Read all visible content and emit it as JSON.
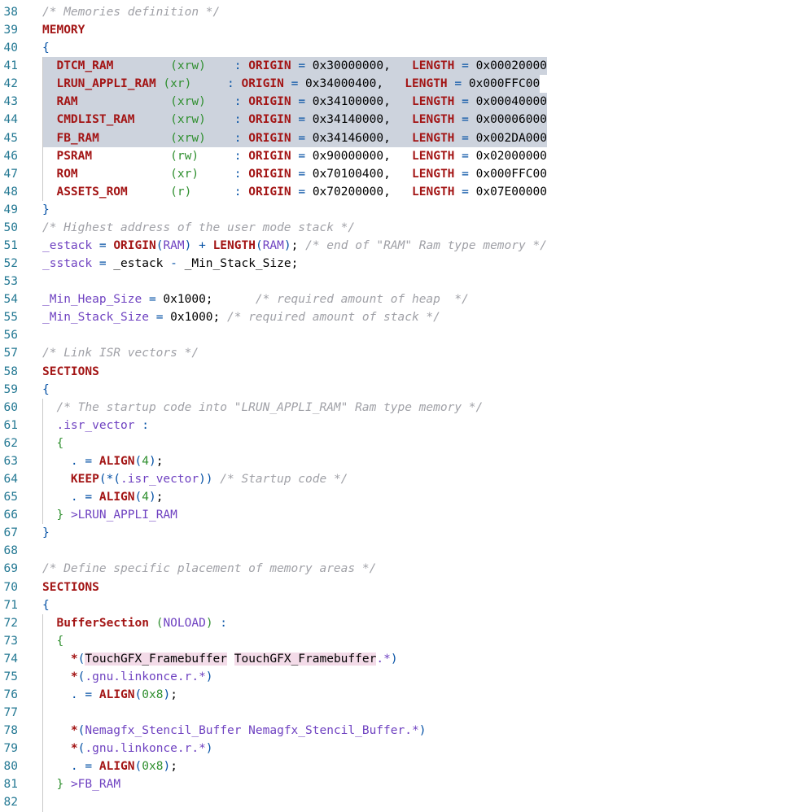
{
  "editor": {
    "lines": [
      {
        "n": "38",
        "tokens": [
          [
            "c",
            "/* Memories definition */"
          ]
        ]
      },
      {
        "n": "39",
        "tokens": [
          [
            "k",
            "MEMORY"
          ]
        ]
      },
      {
        "n": "40",
        "tokens": [
          [
            "p",
            "{"
          ]
        ]
      },
      {
        "n": "41",
        "sel": true,
        "tokens": [
          [
            "t",
            "  "
          ],
          [
            "k",
            "DTCM_RAM"
          ],
          [
            "t",
            "        "
          ],
          [
            "g",
            "(xrw)"
          ],
          [
            "t",
            "    "
          ],
          [
            "p",
            ":"
          ],
          [
            "t",
            " "
          ],
          [
            "k",
            "ORIGIN"
          ],
          [
            "t",
            " "
          ],
          [
            "p",
            "="
          ],
          [
            "t",
            " 0x30000000,   "
          ],
          [
            "k",
            "LENGTH"
          ],
          [
            "t",
            " "
          ],
          [
            "p",
            "="
          ],
          [
            "t",
            " 0x00020000"
          ]
        ]
      },
      {
        "n": "42",
        "sel": true,
        "tokens": [
          [
            "t",
            "  "
          ],
          [
            "k",
            "LRUN_APPLI_RAM"
          ],
          [
            "t",
            " "
          ],
          [
            "g",
            "(xr)"
          ],
          [
            "t",
            "     "
          ],
          [
            "p",
            ":"
          ],
          [
            "t",
            " "
          ],
          [
            "k",
            "ORIGIN"
          ],
          [
            "t",
            " "
          ],
          [
            "p",
            "="
          ],
          [
            "t",
            " 0x34000400,   "
          ],
          [
            "k",
            "LENGTH"
          ],
          [
            "t",
            " "
          ],
          [
            "p",
            "="
          ],
          [
            "t",
            " 0x000FFC00"
          ]
        ]
      },
      {
        "n": "43",
        "sel": true,
        "tokens": [
          [
            "t",
            "  "
          ],
          [
            "k",
            "RAM"
          ],
          [
            "t",
            "             "
          ],
          [
            "g",
            "(xrw)"
          ],
          [
            "t",
            "    "
          ],
          [
            "p",
            ":"
          ],
          [
            "t",
            " "
          ],
          [
            "k",
            "ORIGIN"
          ],
          [
            "t",
            " "
          ],
          [
            "p",
            "="
          ],
          [
            "t",
            " 0x34100000,   "
          ],
          [
            "k",
            "LENGTH"
          ],
          [
            "t",
            " "
          ],
          [
            "p",
            "="
          ],
          [
            "t",
            " 0x00040000"
          ]
        ]
      },
      {
        "n": "44",
        "sel": true,
        "tokens": [
          [
            "t",
            "  "
          ],
          [
            "k",
            "CMDLIST_RAM"
          ],
          [
            "t",
            "     "
          ],
          [
            "g",
            "(xrw)"
          ],
          [
            "t",
            "    "
          ],
          [
            "p",
            ":"
          ],
          [
            "t",
            " "
          ],
          [
            "k",
            "ORIGIN"
          ],
          [
            "t",
            " "
          ],
          [
            "p",
            "="
          ],
          [
            "t",
            " 0x34140000,   "
          ],
          [
            "k",
            "LENGTH"
          ],
          [
            "t",
            " "
          ],
          [
            "p",
            "="
          ],
          [
            "t",
            " 0x00006000"
          ]
        ]
      },
      {
        "n": "45",
        "sel": true,
        "tokens": [
          [
            "t",
            "  "
          ],
          [
            "k",
            "FB_RAM"
          ],
          [
            "t",
            "          "
          ],
          [
            "g",
            "(xrw)"
          ],
          [
            "t",
            "    "
          ],
          [
            "p",
            ":"
          ],
          [
            "t",
            " "
          ],
          [
            "k",
            "ORIGIN"
          ],
          [
            "t",
            " "
          ],
          [
            "p",
            "="
          ],
          [
            "t",
            " 0x34146000,   "
          ],
          [
            "k",
            "LENGTH"
          ],
          [
            "t",
            " "
          ],
          [
            "p",
            "="
          ],
          [
            "t",
            " 0x002DA000"
          ]
        ]
      },
      {
        "n": "46",
        "tokens": [
          [
            "t",
            "  "
          ],
          [
            "k",
            "PSRAM"
          ],
          [
            "t",
            "           "
          ],
          [
            "g",
            "(rw)"
          ],
          [
            "t",
            "     "
          ],
          [
            "p",
            ":"
          ],
          [
            "t",
            " "
          ],
          [
            "k",
            "ORIGIN"
          ],
          [
            "t",
            " "
          ],
          [
            "p",
            "="
          ],
          [
            "t",
            " 0x90000000,   "
          ],
          [
            "k",
            "LENGTH"
          ],
          [
            "t",
            " "
          ],
          [
            "p",
            "="
          ],
          [
            "t",
            " 0x02000000"
          ]
        ]
      },
      {
        "n": "47",
        "tokens": [
          [
            "t",
            "  "
          ],
          [
            "k",
            "ROM"
          ],
          [
            "t",
            "             "
          ],
          [
            "g",
            "(xr)"
          ],
          [
            "t",
            "     "
          ],
          [
            "p",
            ":"
          ],
          [
            "t",
            " "
          ],
          [
            "k",
            "ORIGIN"
          ],
          [
            "t",
            " "
          ],
          [
            "p",
            "="
          ],
          [
            "t",
            " 0x70100400,   "
          ],
          [
            "k",
            "LENGTH"
          ],
          [
            "t",
            " "
          ],
          [
            "p",
            "="
          ],
          [
            "t",
            " 0x000FFC00"
          ]
        ]
      },
      {
        "n": "48",
        "tokens": [
          [
            "t",
            "  "
          ],
          [
            "k",
            "ASSETS_ROM"
          ],
          [
            "t",
            "      "
          ],
          [
            "g",
            "(r)"
          ],
          [
            "t",
            "      "
          ],
          [
            "p",
            ":"
          ],
          [
            "t",
            " "
          ],
          [
            "k",
            "ORIGIN"
          ],
          [
            "t",
            " "
          ],
          [
            "p",
            "="
          ],
          [
            "t",
            " 0x70200000,   "
          ],
          [
            "k",
            "LENGTH"
          ],
          [
            "t",
            " "
          ],
          [
            "p",
            "="
          ],
          [
            "t",
            " 0x07E00000"
          ]
        ]
      },
      {
        "n": "49",
        "tokens": [
          [
            "p",
            "}"
          ]
        ]
      },
      {
        "n": "50",
        "tokens": [
          [
            "c",
            "/* Highest address of the user mode stack */"
          ]
        ]
      },
      {
        "n": "51",
        "tokens": [
          [
            "n",
            "_estack"
          ],
          [
            "t",
            " "
          ],
          [
            "p",
            "="
          ],
          [
            "t",
            " "
          ],
          [
            "k",
            "ORIGIN"
          ],
          [
            "p",
            "("
          ],
          [
            "n",
            "RAM"
          ],
          [
            "p",
            ")"
          ],
          [
            "t",
            " "
          ],
          [
            "p",
            "+"
          ],
          [
            "t",
            " "
          ],
          [
            "k",
            "LENGTH"
          ],
          [
            "p",
            "("
          ],
          [
            "n",
            "RAM"
          ],
          [
            "p",
            ")"
          ],
          [
            "t",
            "; "
          ],
          [
            "c",
            "/* end of \"RAM\" Ram type memory */"
          ]
        ]
      },
      {
        "n": "52",
        "tokens": [
          [
            "n",
            "_sstack"
          ],
          [
            "t",
            " "
          ],
          [
            "p",
            "="
          ],
          [
            "t",
            " _estack "
          ],
          [
            "p",
            "-"
          ],
          [
            "t",
            " _Min_Stack_Size;"
          ]
        ]
      },
      {
        "n": "53",
        "tokens": []
      },
      {
        "n": "54",
        "tokens": [
          [
            "n",
            "_Min_Heap_Size"
          ],
          [
            "t",
            " "
          ],
          [
            "p",
            "="
          ],
          [
            "t",
            " 0x1000;      "
          ],
          [
            "c",
            "/* required amount of heap  */"
          ]
        ]
      },
      {
        "n": "55",
        "tokens": [
          [
            "n",
            "_Min_Stack_Size"
          ],
          [
            "t",
            " "
          ],
          [
            "p",
            "="
          ],
          [
            "t",
            " 0x1000; "
          ],
          [
            "c",
            "/* required amount of stack */"
          ]
        ]
      },
      {
        "n": "56",
        "tokens": []
      },
      {
        "n": "57",
        "tokens": [
          [
            "c",
            "/* Link ISR vectors */"
          ]
        ]
      },
      {
        "n": "58",
        "tokens": [
          [
            "k",
            "SECTIONS"
          ]
        ]
      },
      {
        "n": "59",
        "tokens": [
          [
            "p",
            "{"
          ]
        ]
      },
      {
        "n": "60",
        "tokens": [
          [
            "t",
            "  "
          ],
          [
            "c",
            "/* The startup code into \"LRUN_APPLI_RAM\" Ram type memory */"
          ]
        ]
      },
      {
        "n": "61",
        "tokens": [
          [
            "t",
            "  "
          ],
          [
            "n",
            ".isr_vector"
          ],
          [
            "t",
            " "
          ],
          [
            "p",
            ":"
          ]
        ]
      },
      {
        "n": "62",
        "tokens": [
          [
            "t",
            "  "
          ],
          [
            "g",
            "{"
          ]
        ]
      },
      {
        "n": "63",
        "tokens": [
          [
            "t",
            "    "
          ],
          [
            "p",
            "."
          ],
          [
            "t",
            " "
          ],
          [
            "p",
            "="
          ],
          [
            "t",
            " "
          ],
          [
            "k",
            "ALIGN"
          ],
          [
            "p",
            "("
          ],
          [
            "g",
            "4"
          ],
          [
            "p",
            ")"
          ],
          [
            "t",
            ";"
          ]
        ]
      },
      {
        "n": "64",
        "tokens": [
          [
            "t",
            "    "
          ],
          [
            "k",
            "KEEP"
          ],
          [
            "p",
            "(*("
          ],
          [
            "n",
            ".isr_vector"
          ],
          [
            "p",
            "))"
          ],
          [
            "t",
            " "
          ],
          [
            "c",
            "/* Startup code */"
          ]
        ]
      },
      {
        "n": "65",
        "tokens": [
          [
            "t",
            "    "
          ],
          [
            "p",
            "."
          ],
          [
            "t",
            " "
          ],
          [
            "p",
            "="
          ],
          [
            "t",
            " "
          ],
          [
            "k",
            "ALIGN"
          ],
          [
            "p",
            "("
          ],
          [
            "g",
            "4"
          ],
          [
            "p",
            ")"
          ],
          [
            "t",
            ";"
          ]
        ]
      },
      {
        "n": "66",
        "tokens": [
          [
            "t",
            "  "
          ],
          [
            "g",
            "}"
          ],
          [
            "t",
            " "
          ],
          [
            "n",
            ">LRUN_APPLI_RAM"
          ]
        ]
      },
      {
        "n": "67",
        "tokens": [
          [
            "p",
            "}"
          ]
        ]
      },
      {
        "n": "68",
        "tokens": []
      },
      {
        "n": "69",
        "tokens": [
          [
            "c",
            "/* Define specific placement of memory areas */"
          ]
        ]
      },
      {
        "n": "70",
        "tokens": [
          [
            "k",
            "SECTIONS"
          ]
        ]
      },
      {
        "n": "71",
        "tokens": [
          [
            "p",
            "{"
          ]
        ]
      },
      {
        "n": "72",
        "tokens": [
          [
            "t",
            "  "
          ],
          [
            "k",
            "BufferSection"
          ],
          [
            "t",
            " "
          ],
          [
            "g",
            "("
          ],
          [
            "n",
            "NOLOAD"
          ],
          [
            "g",
            ")"
          ],
          [
            "t",
            " "
          ],
          [
            "p",
            ":"
          ]
        ]
      },
      {
        "n": "73",
        "tokens": [
          [
            "t",
            "  "
          ],
          [
            "g",
            "{"
          ]
        ]
      },
      {
        "n": "74",
        "tokens": [
          [
            "t",
            "    "
          ],
          [
            "k",
            "*"
          ],
          [
            "p",
            "("
          ],
          [
            "wh",
            "TouchGFX_Framebuffer"
          ],
          [
            "t",
            " "
          ],
          [
            "wh",
            "TouchGFX_Framebuffer"
          ],
          [
            "n",
            ".*"
          ],
          [
            "p",
            ")"
          ]
        ]
      },
      {
        "n": "75",
        "tokens": [
          [
            "t",
            "    "
          ],
          [
            "k",
            "*"
          ],
          [
            "p",
            "("
          ],
          [
            "n",
            ".gnu.linkonce.r.*"
          ],
          [
            "p",
            ")"
          ]
        ]
      },
      {
        "n": "76",
        "tokens": [
          [
            "t",
            "    "
          ],
          [
            "p",
            "."
          ],
          [
            "t",
            " "
          ],
          [
            "p",
            "="
          ],
          [
            "t",
            " "
          ],
          [
            "k",
            "ALIGN"
          ],
          [
            "p",
            "("
          ],
          [
            "g",
            "0x8"
          ],
          [
            "p",
            ")"
          ],
          [
            "t",
            ";"
          ]
        ]
      },
      {
        "n": "77",
        "tokens": []
      },
      {
        "n": "78",
        "tokens": [
          [
            "t",
            "    "
          ],
          [
            "k",
            "*"
          ],
          [
            "p",
            "("
          ],
          [
            "n",
            "Nemagfx_Stencil_Buffer Nemagfx_Stencil_Buffer.*"
          ],
          [
            "p",
            ")"
          ]
        ]
      },
      {
        "n": "79",
        "tokens": [
          [
            "t",
            "    "
          ],
          [
            "k",
            "*"
          ],
          [
            "p",
            "("
          ],
          [
            "n",
            ".gnu.linkonce.r.*"
          ],
          [
            "p",
            ")"
          ]
        ]
      },
      {
        "n": "80",
        "tokens": [
          [
            "t",
            "    "
          ],
          [
            "p",
            "."
          ],
          [
            "t",
            " "
          ],
          [
            "p",
            "="
          ],
          [
            "t",
            " "
          ],
          [
            "k",
            "ALIGN"
          ],
          [
            "p",
            "("
          ],
          [
            "g",
            "0x8"
          ],
          [
            "p",
            ")"
          ],
          [
            "t",
            ";"
          ]
        ]
      },
      {
        "n": "81",
        "tokens": [
          [
            "t",
            "  "
          ],
          [
            "g",
            "}"
          ],
          [
            "t",
            " "
          ],
          [
            "n",
            ">FB_RAM"
          ]
        ]
      },
      {
        "n": "82",
        "tokens": []
      }
    ]
  }
}
